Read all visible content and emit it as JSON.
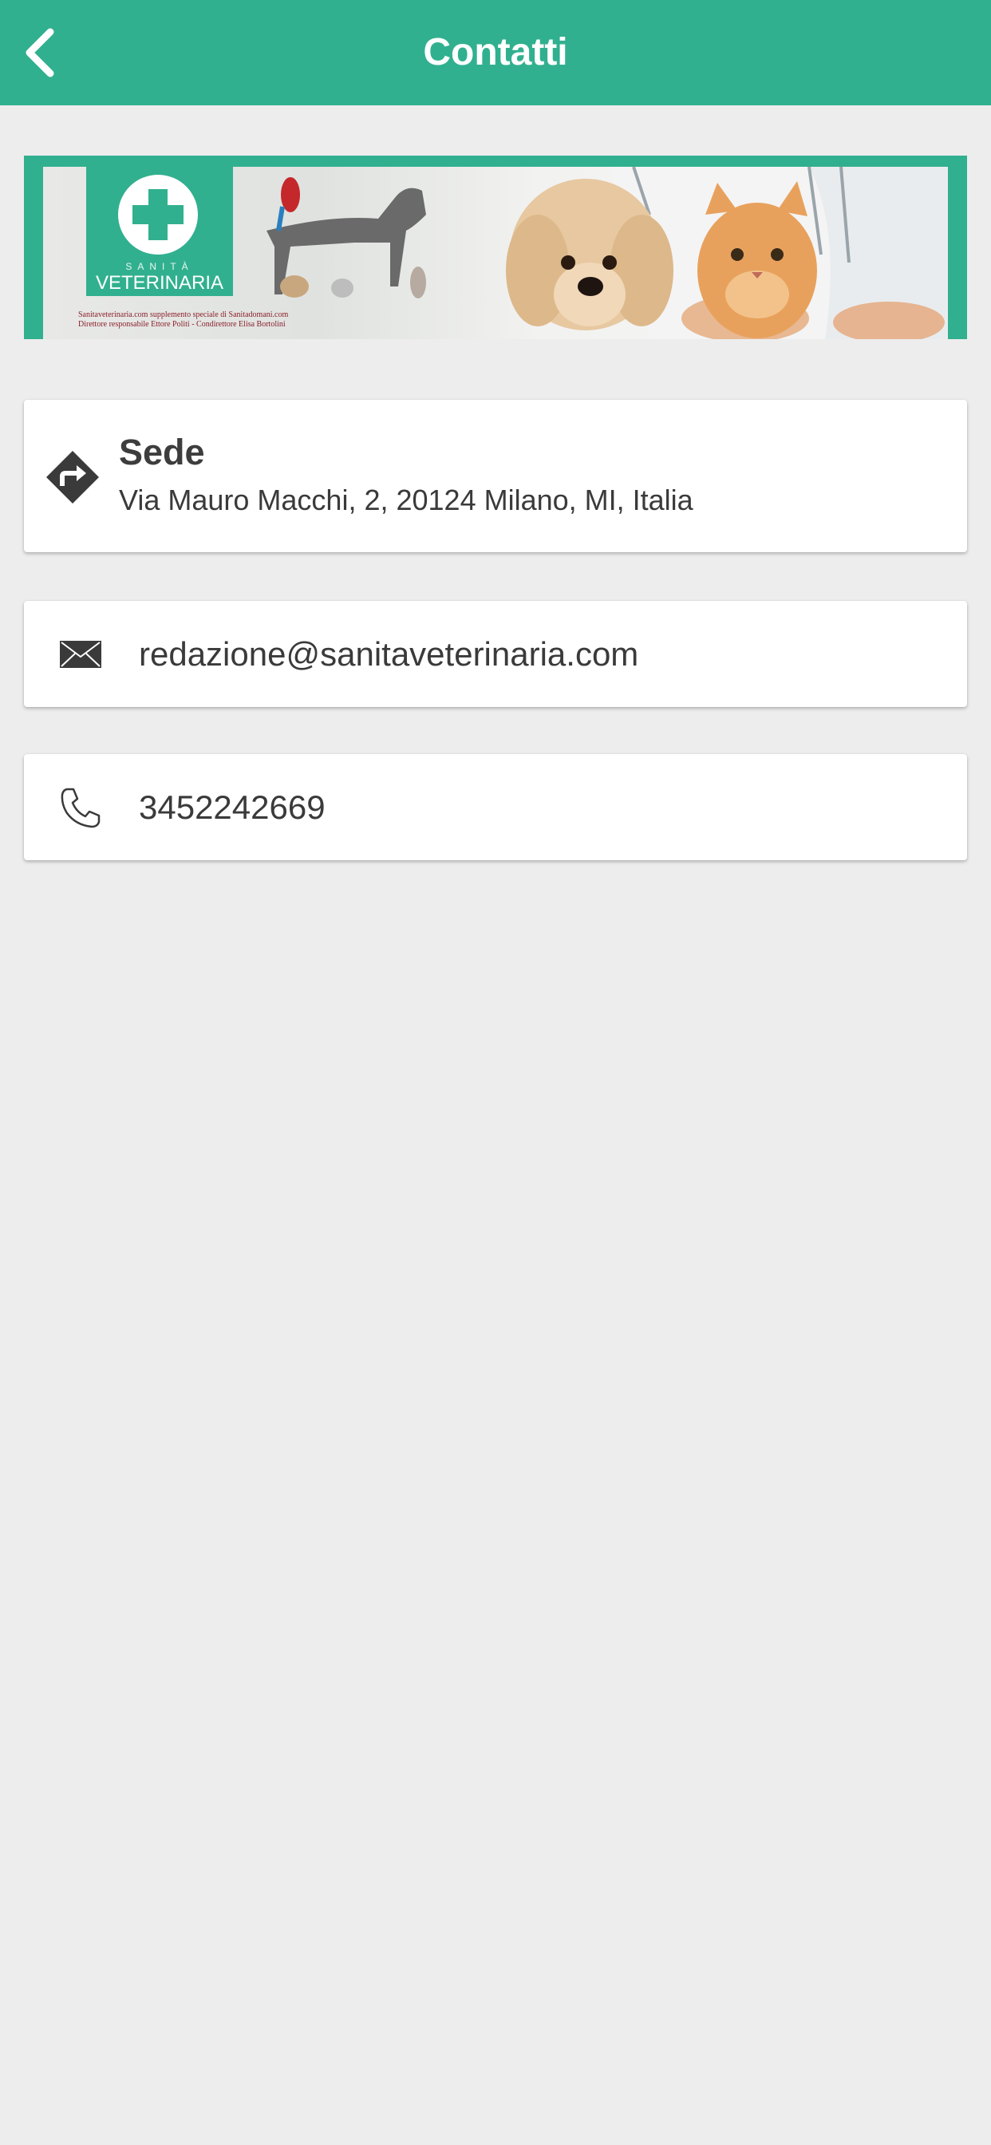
{
  "header": {
    "title": "Contatti",
    "background_color": "#31b08f",
    "back_icon": "chevron-left-icon"
  },
  "banner": {
    "logo_subtitle": "SANITÀ",
    "logo_title": "VETERINARIA",
    "credit_line_1": "Sanitaveterinaria.com supplemento speciale di Sanitadomani.com",
    "credit_line_2": "Direttore responsabile Ettore Politi - Condirettore Elisa Bortolini"
  },
  "contacts": {
    "address": {
      "label": "Sede",
      "value": "Via Mauro Macchi, 2, 20124 Milano, MI, Italia",
      "icon": "directions-icon"
    },
    "email": {
      "value": "redazione@sanitaveterinaria.com",
      "icon": "envelope-icon"
    },
    "phone": {
      "value": "3452242669",
      "icon": "phone-icon"
    }
  }
}
